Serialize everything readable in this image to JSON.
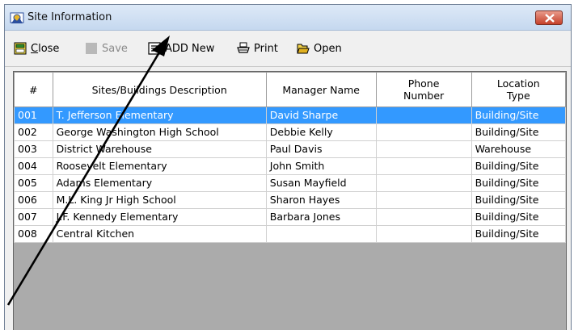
{
  "window": {
    "title": "Site Information"
  },
  "toolbar": {
    "close": {
      "mnemonic": "C",
      "rest": "lose"
    },
    "save": "Save",
    "add_new": "ADD New",
    "print": "Print",
    "open": "Open"
  },
  "table": {
    "headers": [
      "#",
      "Sites/Buildings Description",
      "Manager Name",
      "Phone Number",
      "Location Type"
    ],
    "rows": [
      {
        "num": "001",
        "description": "T. Jefferson Elementary",
        "manager": "David Sharpe",
        "phone": "",
        "type": "Building/Site",
        "selected": true
      },
      {
        "num": "002",
        "description": "George Washington High School",
        "manager": "Debbie Kelly",
        "phone": "",
        "type": "Building/Site"
      },
      {
        "num": "003",
        "description": "District Warehouse",
        "manager": "Paul Davis",
        "phone": "",
        "type": "Warehouse"
      },
      {
        "num": "004",
        "description": "Roosevelt Elementary",
        "manager": "John Smith",
        "phone": "",
        "type": "Building/Site"
      },
      {
        "num": "005",
        "description": "Adams Elementary",
        "manager": "Susan Mayfield",
        "phone": "",
        "type": "Building/Site"
      },
      {
        "num": "006",
        "description": "M.L. King Jr High School",
        "manager": "Sharon Hayes",
        "phone": "",
        "type": "Building/Site"
      },
      {
        "num": "007",
        "description": "J.F. Kennedy Elementary",
        "manager": "Barbara Jones",
        "phone": "",
        "type": "Building/Site"
      },
      {
        "num": "008",
        "description": "Central Kitchen",
        "manager": "",
        "phone": "",
        "type": "Building/Site"
      }
    ]
  },
  "colors": {
    "selection": "#3399ff",
    "grid_background": "#ababab",
    "close_button": "#c5402a"
  }
}
